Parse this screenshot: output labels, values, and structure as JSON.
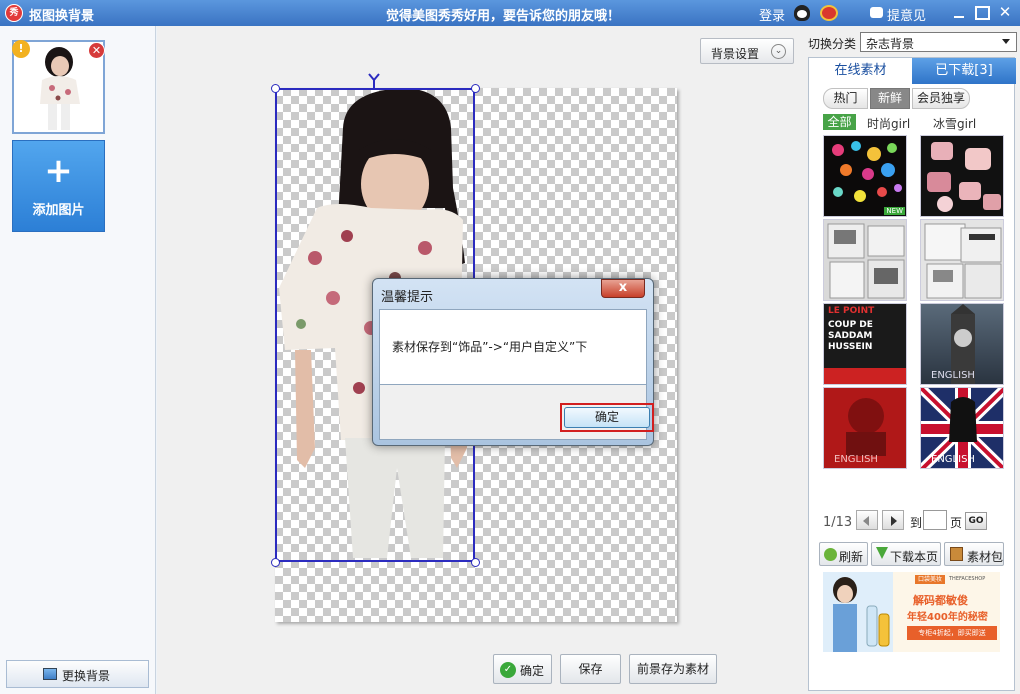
{
  "titlebar": {
    "app_icon_text": "秀",
    "title": "抠图换背景",
    "slogan": "觉得美图秀秀好用，要告诉您的朋友哦！",
    "login": "登录",
    "feedback": "提意见",
    "close_symbol": "✕"
  },
  "left_panel": {
    "thumb_badge": "!",
    "thumb_delete": "✕",
    "add_image_symbol": "+",
    "add_image_label": "添加图片",
    "change_bg_label": "更换背景"
  },
  "canvas": {
    "bg_settings_label": "背景设置",
    "bg_settings_chevron": "⌄",
    "confirm_icon": "✓",
    "confirm_label": "确定",
    "save_label": "保存",
    "fg_save_label": "前景存为素材"
  },
  "dialog": {
    "title": "温馨提示",
    "close_symbol": "x",
    "message": "素材保存到“饰品”->“用户自定义”下",
    "ok_label": "确定"
  },
  "right_panel": {
    "category_label": "切换分类",
    "category_value": "杂志背景",
    "tab_online": "在线素材",
    "tab_downloaded": "已下载[3]",
    "sub_hot": "热门",
    "sub_new": "新鲜",
    "sub_vip": "会员独享",
    "filter_all": "全部",
    "filter_fashion": "时尚girl",
    "filter_ice": "冰雪girl",
    "tiles": [
      {
        "name": "hearts-bokeh",
        "badge": "NEW"
      },
      {
        "name": "cosmetics-pink"
      },
      {
        "name": "newspaper-collage-1"
      },
      {
        "name": "newspaper-la-paix"
      },
      {
        "name": "le-point-coup-de-saddam",
        "text_top": "LE POINT",
        "text_mid": "COUP DE SADDAM HUSSEIN"
      },
      {
        "name": "big-ben-clock",
        "caption": "ENGLISH"
      },
      {
        "name": "red-english",
        "caption": "ENGLISH"
      },
      {
        "name": "union-jack-english",
        "caption": "ENGLISH"
      }
    ],
    "pager_text": "1/13",
    "pager_to": "到",
    "pager_page": "页",
    "pager_go": "GO",
    "refresh_label": "刷新",
    "download_page_label": "下载本页",
    "pack_label": "素材包",
    "ad": {
      "brand": "口袋美妆",
      "shop": "THEFACESHOP",
      "headline1": "解码都敏俊",
      "headline2": "年轻400年的秘密",
      "cta": "专柜4折起，即买即送"
    }
  }
}
